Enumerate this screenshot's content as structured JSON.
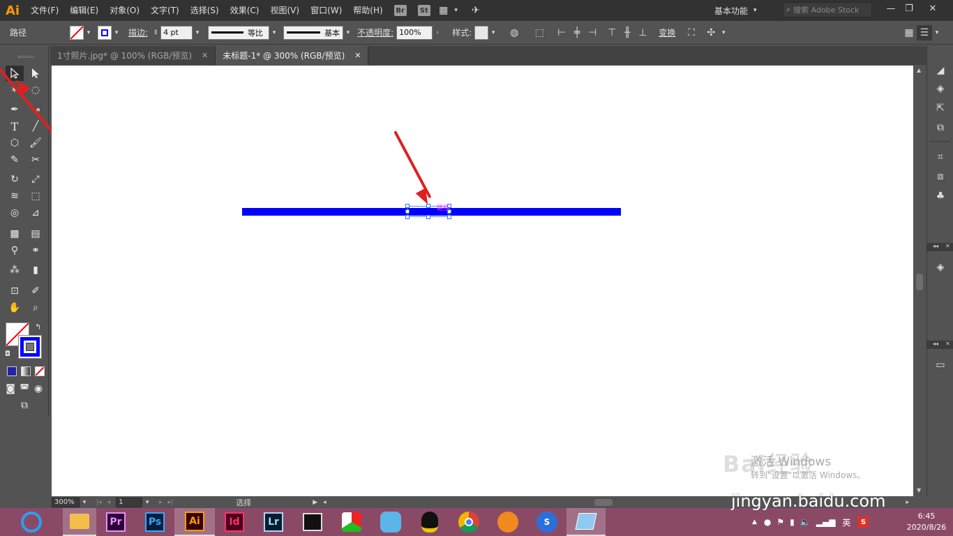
{
  "app": {
    "logo": "Ai"
  },
  "menu": [
    "文件(F)",
    "编辑(E)",
    "对象(O)",
    "文字(T)",
    "选择(S)",
    "效果(C)",
    "视图(V)",
    "窗口(W)",
    "帮助(H)"
  ],
  "bridge_badges": [
    "Br",
    "St"
  ],
  "workspace": {
    "label": "基本功能"
  },
  "search": {
    "placeholder": "搜索 Adobe Stock"
  },
  "window_controls": {
    "minimize": "—",
    "restore": "❐",
    "close": "✕"
  },
  "control": {
    "object_type": "路径",
    "stroke_label": "描边",
    "stroke_weight": "4 pt",
    "profile_label": "等比",
    "brush_label": "基本",
    "opacity_label": "不透明度",
    "opacity_value": "100%",
    "style_label": "样式",
    "transform_label": "变换"
  },
  "colors": {
    "stroke": "#0000ff",
    "accent": "#ff9a00",
    "canvas": "#ffffff",
    "arrow": "#e02020"
  },
  "tabs": [
    {
      "label": "1寸照片.jpg* @ 100% (RGB/预览)",
      "close": "✕"
    },
    {
      "label": "未标题-1* @ 300% (RGB/预览)",
      "close": "✕"
    }
  ],
  "canvas": {
    "path_label": "路径"
  },
  "status": {
    "zoom": "300%",
    "artboard": "1",
    "tool": "选择"
  },
  "watermark": {
    "line1": "激活 Windows",
    "line2": "转到\"设置\"以激活 Windows。",
    "site": "jingyan.baidu.com",
    "brand": "Bai经验"
  },
  "tray": {
    "ime": "英",
    "time": "6:45",
    "date": "2020/8/26"
  },
  "taskbar_apps": [
    "Pr",
    "Ps",
    "Ai",
    "Id",
    "Lr"
  ]
}
